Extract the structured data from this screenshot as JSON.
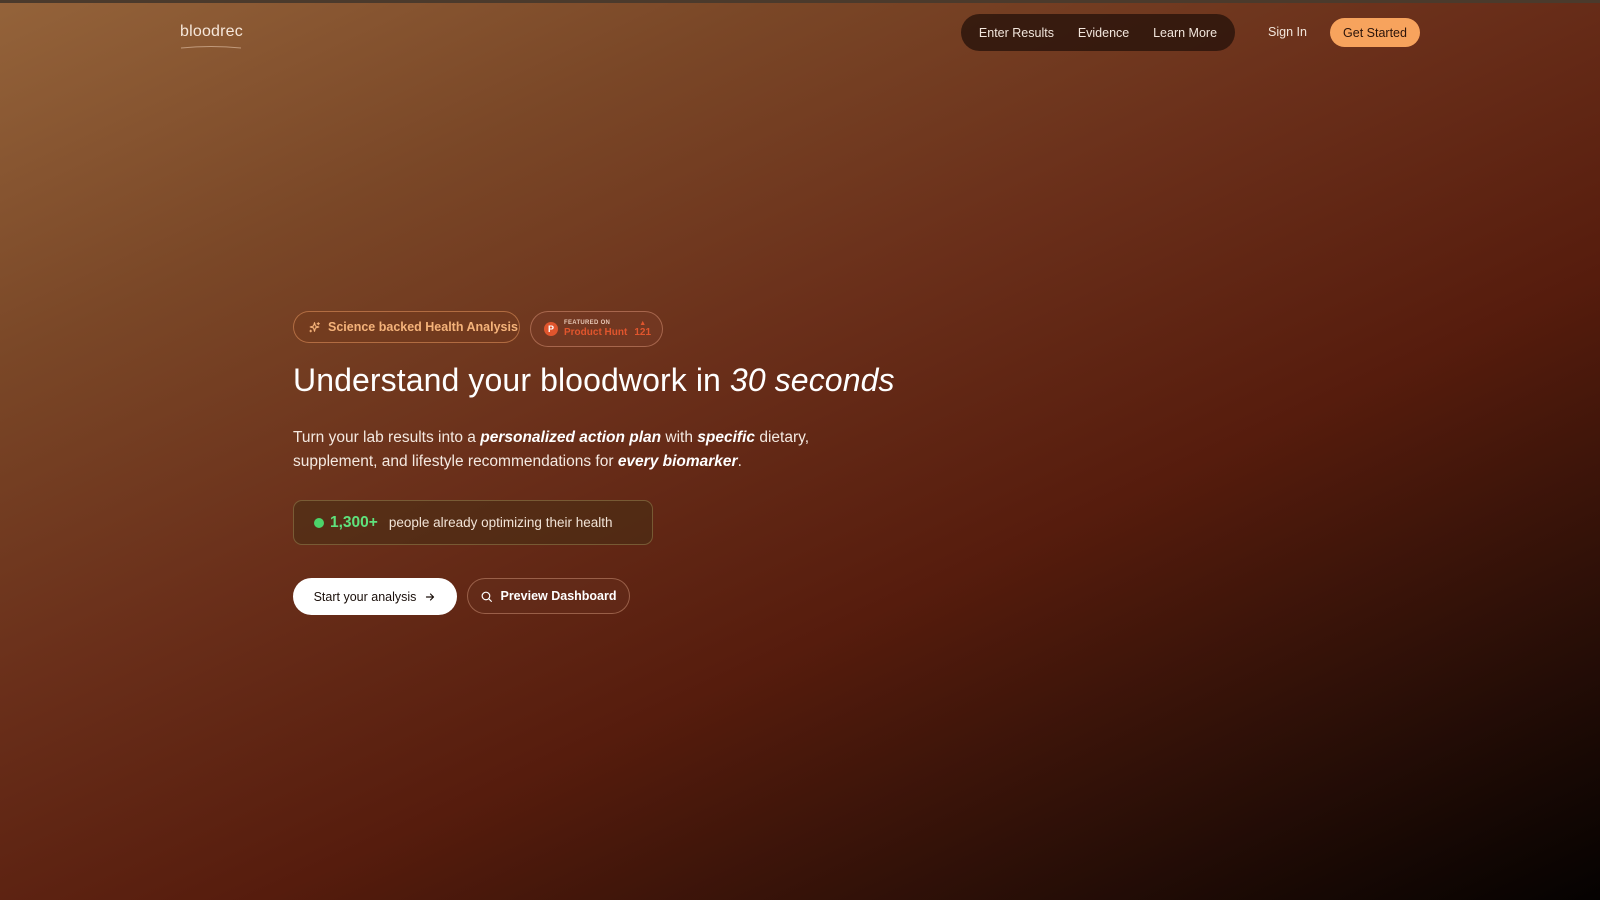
{
  "header": {
    "logo": "bloodrec",
    "nav": [
      {
        "label": "Enter Results"
      },
      {
        "label": "Evidence"
      },
      {
        "label": "Learn More"
      }
    ],
    "sign_in": "Sign In",
    "get_started": "Get Started"
  },
  "hero": {
    "badge_science": "Science backed Health Analysis",
    "product_hunt": {
      "featured": "FEATURED ON",
      "name": "Product Hunt",
      "logo_letter": "P",
      "upvotes": "121"
    },
    "headline": {
      "lead": "Understand your bloodwork in ",
      "emphasis": "30 seconds"
    },
    "subtext": {
      "p1": "Turn your lab results into a ",
      "e1": "personalized action plan",
      "p2": " with ",
      "e2": "specific",
      "p3": " dietary, supplement, and lifestyle recommendations for ",
      "e3": "every biomarker",
      "p4": "."
    },
    "social_proof": {
      "count": "1,300+",
      "text": "people already optimizing their health"
    },
    "cta_primary": "Start your analysis",
    "cta_secondary": "Preview Dashboard"
  },
  "colors": {
    "accent": "#f7a35d",
    "badge_text": "#f5b37a",
    "product_hunt": "#e0552d",
    "status_green": "#4cd46a"
  },
  "icons": {
    "badge": "sparkle-icon",
    "cta_primary": "arrow-right-icon",
    "cta_secondary": "search-icon"
  }
}
